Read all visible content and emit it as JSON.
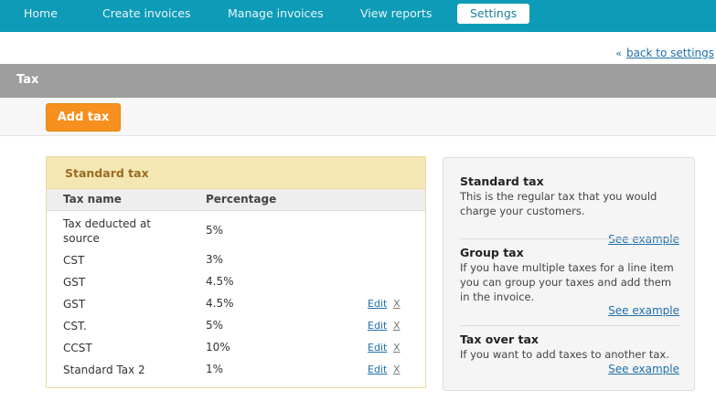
{
  "nav": {
    "items": [
      "Home",
      "Create invoices",
      "Manage invoices",
      "View reports",
      "Settings"
    ],
    "active": "Settings"
  },
  "back_link": "back to settings",
  "section": {
    "title": "Tax"
  },
  "toolbar": {
    "add_label": "Add tax"
  },
  "panel": {
    "title": "Standard tax",
    "columns": [
      "Tax name",
      "Percentage"
    ],
    "edit_label": "Edit",
    "delete_label": "X",
    "rows": [
      {
        "name": "Tax deducted at source",
        "percentage": "5%",
        "editable": false
      },
      {
        "name": "CST",
        "percentage": "3%",
        "editable": false
      },
      {
        "name": "GST",
        "percentage": "4.5%",
        "editable": false
      },
      {
        "name": "GST",
        "percentage": "4.5%",
        "editable": true
      },
      {
        "name": "CST.",
        "percentage": "5%",
        "editable": true
      },
      {
        "name": "CCST",
        "percentage": "10%",
        "editable": true
      },
      {
        "name": "Standard Tax 2",
        "percentage": "1%",
        "editable": true
      }
    ]
  },
  "info": {
    "blocks": [
      {
        "title": "Standard tax",
        "text": "This is the regular tax that you would charge your customers.",
        "link": "See example"
      },
      {
        "title": "Group tax",
        "text": "If you have multiple taxes for a line item you can group your taxes and add them in the invoice.",
        "link": "See example"
      },
      {
        "title": "Tax over tax",
        "text": "If you want to add taxes to another tax.",
        "link": "See example"
      }
    ]
  },
  "colors": {
    "nav_bg": "#0e9bb7",
    "accent_orange": "#f7901e",
    "panel_header": "#f5e7b3",
    "section_bar": "#9e9e9e",
    "link": "#1f6fa8"
  }
}
